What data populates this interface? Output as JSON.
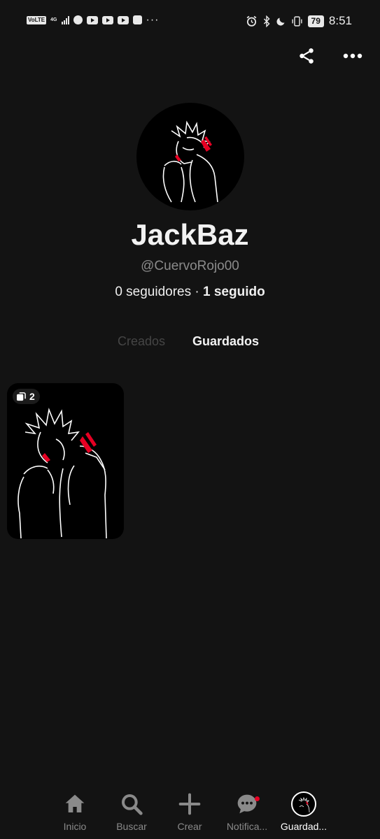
{
  "status_bar": {
    "volte": "VoLTE",
    "network": "4G",
    "battery": "79",
    "time": "8:51",
    "icons": [
      "spotify-icon",
      "youtube-icon",
      "youtube-icon",
      "youtube-icon",
      "app-icon",
      "alarm-icon",
      "bluetooth-icon",
      "moon-icon",
      "vibrate-icon"
    ]
  },
  "profile": {
    "name": "JackBaz",
    "handle": "@CuervoRojo00",
    "followers": "0 seguidores",
    "separator": " · ",
    "following": "1 seguido"
  },
  "tabs": [
    {
      "label": "Creados",
      "active": false
    },
    {
      "label": "Guardados",
      "active": true
    }
  ],
  "boards": [
    {
      "pin_count": "2"
    }
  ],
  "nav": [
    {
      "label": "Inicio",
      "icon": "home-icon"
    },
    {
      "label": "Buscar",
      "icon": "search-icon"
    },
    {
      "label": "Crear",
      "icon": "plus-icon"
    },
    {
      "label": "Notifica...",
      "icon": "chat-icon"
    },
    {
      "label": "Guardad...",
      "icon": "avatar-icon"
    }
  ],
  "colors": {
    "background": "#131313",
    "accent_red": "#e60023",
    "muted_text": "#8b8b8b"
  }
}
